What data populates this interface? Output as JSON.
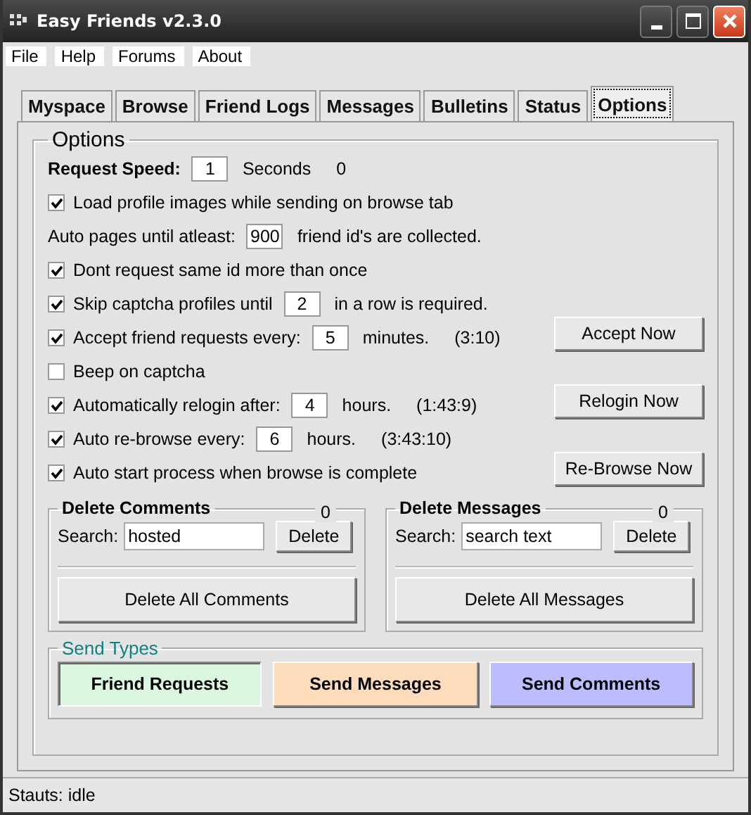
{
  "window": {
    "title": "Easy Friends v2.3.0"
  },
  "menu": [
    "File",
    "Help",
    "Forums",
    "About"
  ],
  "tabs": [
    {
      "label": "Myspace",
      "selected": false
    },
    {
      "label": "Browse",
      "selected": false
    },
    {
      "label": "Friend Logs",
      "selected": false
    },
    {
      "label": "Messages",
      "selected": false
    },
    {
      "label": "Bulletins",
      "selected": false
    },
    {
      "label": "Status",
      "selected": false
    },
    {
      "label": "Options",
      "selected": true
    }
  ],
  "options": {
    "title": "Options",
    "rows": [
      {
        "kind": "bold",
        "label": "Request Speed:",
        "value": "1",
        "suffix": "Seconds",
        "extra": "0"
      },
      {
        "kind": "check",
        "checked": true,
        "label": "Load profile images while sending on browse tab"
      },
      {
        "kind": "plain",
        "label": "Auto pages until atleast:",
        "value": "900",
        "suffix": "friend id's are collected."
      },
      {
        "kind": "check",
        "checked": true,
        "label": "Dont request same id more than once"
      },
      {
        "kind": "check",
        "checked": true,
        "label": "Skip captcha profiles until",
        "value": "2",
        "suffix": "in a row is required."
      },
      {
        "kind": "check",
        "checked": true,
        "label": "Accept friend requests every:",
        "value": "5",
        "suffix": "minutes.",
        "extra": "(3:10)",
        "action": "Accept Now"
      },
      {
        "kind": "check",
        "checked": false,
        "label": "Beep on captcha"
      },
      {
        "kind": "check",
        "checked": true,
        "label": "Automatically relogin after:",
        "value": "4",
        "suffix": "hours.",
        "extra": "(1:43:9)",
        "action": "Relogin Now"
      },
      {
        "kind": "check",
        "checked": true,
        "label": "Auto re-browse every:",
        "value": "6",
        "suffix": "hours.",
        "extra": "(3:43:10)"
      },
      {
        "kind": "check",
        "checked": true,
        "label": "Auto start process when browse is complete",
        "action": "Re-Browse Now"
      }
    ]
  },
  "delete_groups": [
    {
      "title": "Delete Comments",
      "count": "0",
      "search_label": "Search:",
      "value": "hosted",
      "delete_button": "Delete",
      "delete_all_button": "Delete All Comments"
    },
    {
      "title": "Delete Messages",
      "count": "0",
      "search_label": "Search:",
      "value": "search text",
      "delete_button": "Delete",
      "delete_all_button": "Delete All Messages"
    }
  ],
  "send_types": {
    "title": "Send Types",
    "buttons": [
      {
        "label": "Friend Requests",
        "color": "#dcf7e0",
        "selected": true
      },
      {
        "label": "Send Messages",
        "color": "#ffdcbc",
        "selected": false
      },
      {
        "label": "Send Comments",
        "color": "#bcbcff",
        "selected": false
      }
    ]
  },
  "status_bar": "Stauts: idle"
}
